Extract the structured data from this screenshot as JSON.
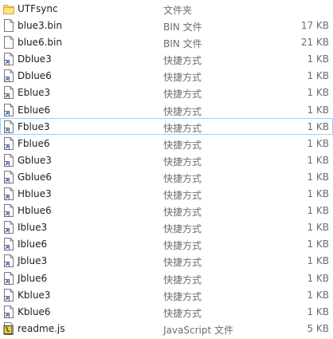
{
  "files": [
    {
      "name": "UTFsync",
      "type": "文件夹",
      "size": "",
      "icon": "folder-icon"
    },
    {
      "name": "blue3.bin",
      "type": "BIN 文件",
      "size": "17 KB",
      "icon": "file-icon"
    },
    {
      "name": "blue6.bin",
      "type": "BIN 文件",
      "size": "21 KB",
      "icon": "file-icon"
    },
    {
      "name": "Dblue3",
      "type": "快捷方式",
      "size": "1 KB",
      "icon": "shortcut-icon"
    },
    {
      "name": "Dblue6",
      "type": "快捷方式",
      "size": "1 KB",
      "icon": "shortcut-icon"
    },
    {
      "name": "Eblue3",
      "type": "快捷方式",
      "size": "1 KB",
      "icon": "shortcut-icon"
    },
    {
      "name": "Eblue6",
      "type": "快捷方式",
      "size": "1 KB",
      "icon": "shortcut-icon"
    },
    {
      "name": "Fblue3",
      "type": "快捷方式",
      "size": "1 KB",
      "icon": "shortcut-icon"
    },
    {
      "name": "Fblue6",
      "type": "快捷方式",
      "size": "1 KB",
      "icon": "shortcut-icon"
    },
    {
      "name": "Gblue3",
      "type": "快捷方式",
      "size": "1 KB",
      "icon": "shortcut-icon"
    },
    {
      "name": "Gblue6",
      "type": "快捷方式",
      "size": "1 KB",
      "icon": "shortcut-icon"
    },
    {
      "name": "Hblue3",
      "type": "快捷方式",
      "size": "1 KB",
      "icon": "shortcut-icon"
    },
    {
      "name": "Hblue6",
      "type": "快捷方式",
      "size": "1 KB",
      "icon": "shortcut-icon"
    },
    {
      "name": "Iblue3",
      "type": "快捷方式",
      "size": "1 KB",
      "icon": "shortcut-icon"
    },
    {
      "name": "Iblue6",
      "type": "快捷方式",
      "size": "1 KB",
      "icon": "shortcut-icon"
    },
    {
      "name": "Jblue3",
      "type": "快捷方式",
      "size": "1 KB",
      "icon": "shortcut-icon"
    },
    {
      "name": "Jblue6",
      "type": "快捷方式",
      "size": "1 KB",
      "icon": "shortcut-icon"
    },
    {
      "name": "Kblue3",
      "type": "快捷方式",
      "size": "1 KB",
      "icon": "shortcut-icon"
    },
    {
      "name": "Kblue6",
      "type": "快捷方式",
      "size": "1 KB",
      "icon": "shortcut-icon"
    },
    {
      "name": "readme.js",
      "type": "JavaScript 文件",
      "size": "5 KB",
      "icon": "javascript-file-icon"
    }
  ],
  "hovered_row_index": 7,
  "colors": {
    "hover_border": "#99d1ff",
    "folder": "#ffd766",
    "secondary_text": "#6d6d6d"
  }
}
